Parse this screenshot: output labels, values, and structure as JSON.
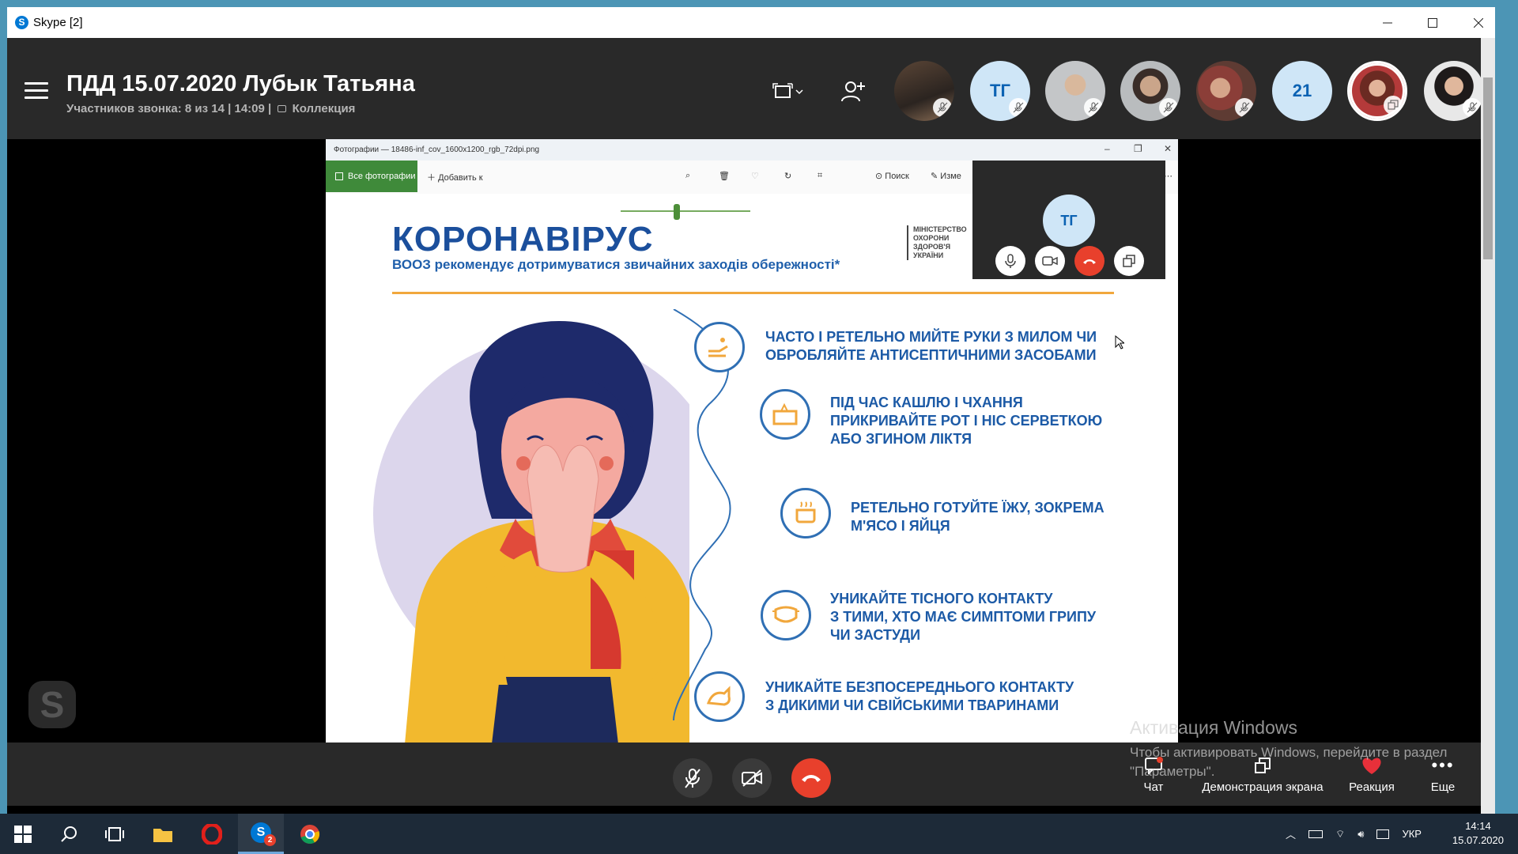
{
  "window": {
    "title": "Skype [2]",
    "app_icon_letter": "S"
  },
  "header": {
    "call_title": "ПДД 15.07.2020 Лубык Татьяна",
    "call_subtitle": "Участников звонка: 8 из 14 | 14:09 |",
    "collection_label": "Коллекция",
    "participants": [
      {
        "type": "photo",
        "muted": true
      },
      {
        "type": "initials",
        "label": "ТГ",
        "muted": true
      },
      {
        "type": "photo",
        "muted": true
      },
      {
        "type": "photo",
        "muted": true
      },
      {
        "type": "photo",
        "muted": true
      },
      {
        "type": "count",
        "label": "21"
      },
      {
        "type": "photo",
        "sharing": true
      },
      {
        "type": "photo",
        "muted": true
      }
    ]
  },
  "share": {
    "window_title": "Фотографии — 18486-inf_cov_1600x1200_rgb_72dpi.png",
    "all_photos_label": "Все фотографии",
    "add_label": "Добавить к",
    "search_label": "Поиск",
    "edit_label": "Изме",
    "mini_call_initials": "ТГ",
    "poster": {
      "title": "КОРОНАВІРУС",
      "subtitle": "ВООЗ рекомендує дотримуватися звичайних заходів обережності*",
      "ministry": [
        "МІНІСТЕРСТВО",
        "ОХОРОНИ",
        "ЗДОРОВ'Я",
        "УКРАЇНИ"
      ],
      "tips": [
        {
          "lines": [
            "ЧАСТО І РЕТЕЛЬНО МИЙТЕ РУКИ З МИЛОМ ЧИ",
            "ОБРОБЛЯЙТЕ АНТИСЕПТИЧНИМИ ЗАСОБАМИ"
          ]
        },
        {
          "lines": [
            "ПІД ЧАС КАШЛЮ І ЧХАННЯ",
            "ПРИКРИВАЙТЕ РОТ І НІС СЕРВЕТКОЮ",
            "АБО ЗГИНОМ ЛІКТЯ"
          ]
        },
        {
          "lines": [
            "РЕТЕЛЬНО ГОТУЙТЕ ЇЖУ, ЗОКРЕМА",
            "М'ЯСО І ЯЙЦЯ"
          ]
        },
        {
          "lines": [
            "УНИКАЙТЕ ТІСНОГО КОНТАКТУ",
            "З ТИМИ, ХТО МАЄ СИМПТОМИ ГРИПУ",
            "ЧИ ЗАСТУДИ"
          ]
        },
        {
          "lines": [
            "УНИКАЙТЕ БЕЗПОСЕРЕДНЬОГО КОНТАКТУ",
            "З ДИКИМИ ЧИ СВІЙСЬКИМИ ТВАРИНАМИ"
          ]
        }
      ]
    }
  },
  "callbar": {
    "chat_label": "Чат",
    "screen_share_label": "Демонстрация экрана",
    "reaction_label": "Реакция",
    "more_label": "Еще"
  },
  "watermark": {
    "title": "Активация Windows",
    "text": "Чтобы активировать Windows, перейдите в раздел \"Параметры\"."
  },
  "taskbar": {
    "skype_badge": "2",
    "language": "УКР",
    "time": "14:14",
    "date": "15.07.2020"
  },
  "colors": {
    "skype_blue": "#0078d4",
    "end_call_red": "#e8402c",
    "poster_blue": "#1b4f9c",
    "photos_green": "#3f8a3a"
  }
}
